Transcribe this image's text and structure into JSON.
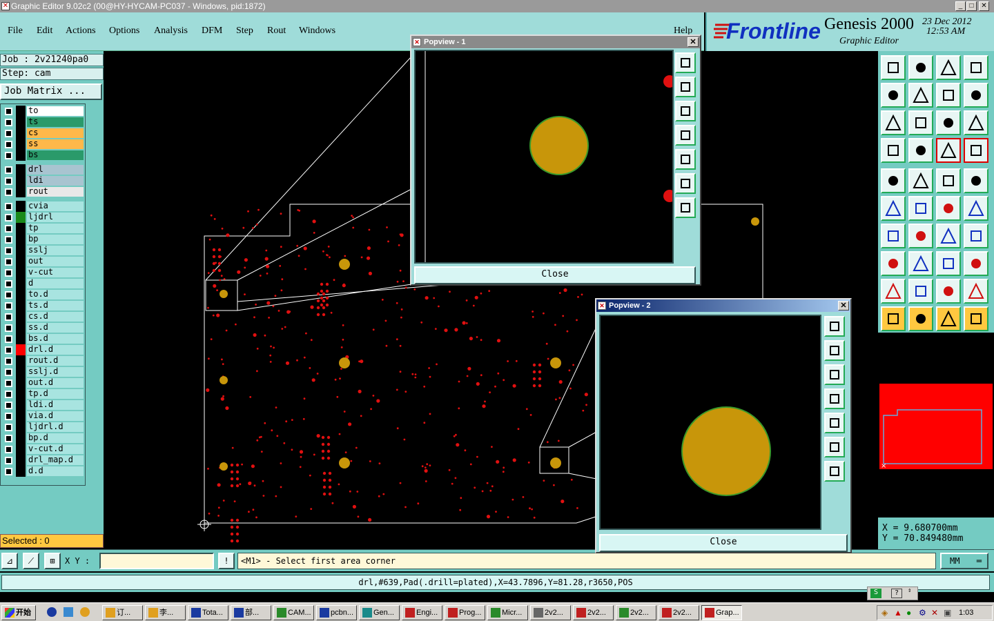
{
  "window": {
    "title": "Graphic Editor 9.02c2 (00@HY-HYCAM-PC037 - Windows, pid:1872)"
  },
  "menu": [
    "File",
    "Edit",
    "Actions",
    "Options",
    "Analysis",
    "DFM",
    "Step",
    "Rout",
    "Windows"
  ],
  "help_label": "Help",
  "logo": {
    "brand": "Frontline",
    "product": "Genesis 2000",
    "subtitle": "Graphic Editor",
    "date": "23 Dec 2012",
    "time": "12:53 AM"
  },
  "job": {
    "job_line": "Job : 2v21240pa0",
    "step_line": "Step: cam",
    "matrix_button": "Job Matrix ..."
  },
  "layers_group1": [
    {
      "name": "to",
      "color": "#ffffff"
    },
    {
      "name": "ts",
      "color": "#2a9a6a"
    },
    {
      "name": "cs",
      "color": "#ffb84a"
    },
    {
      "name": "ss",
      "color": "#ffb84a"
    },
    {
      "name": "bs",
      "color": "#2a9a6a"
    }
  ],
  "layers_group2": [
    {
      "name": "drl",
      "color": "#a8c4d0"
    },
    {
      "name": "ldi",
      "color": "#a8c4d0"
    },
    {
      "name": "rout",
      "color": "#e8e8e8"
    }
  ],
  "layers_group3": [
    "cvia",
    "ljdrl",
    "tp",
    "bp",
    "sslj",
    "out",
    "v-cut",
    "d",
    "to.d",
    "ts.d",
    "cs.d",
    "ss.d",
    "bs.d",
    "drl.d",
    "rout.d",
    "sslj.d",
    "out.d",
    "tp.d",
    "ldi.d",
    "via.d",
    "ljdrl.d",
    "bp.d",
    "v-cut.d",
    "drl_map.d",
    "d.d"
  ],
  "selected_text": "Selected : 0",
  "coords": {
    "x": "X =  9.680700mm",
    "y": "Y = 70.849480mm"
  },
  "cmd": {
    "xy_label": "X Y :",
    "prompt": "<M1> - Select first area corner",
    "units": "MM"
  },
  "status_text": "drl,#639,Pad(.drill=plated),X=43.7896,Y=81.28,r3650,POS",
  "popups": {
    "p1": {
      "title": "Popview - 1",
      "close_label": "Close"
    },
    "p2": {
      "title": "Popview - 2",
      "close_label": "Close"
    }
  },
  "taskbar": {
    "start_label": "开始",
    "clock": "1:03",
    "tasks": [
      "订...",
      "李...",
      "Tota...",
      "部...",
      "CAM...",
      "pcbn...",
      "Gen...",
      "Engi...",
      "Prog...",
      "Micr...",
      "2v2...",
      "2v2...",
      "2v2...",
      "2v2...",
      "Grap..."
    ]
  },
  "colors": {
    "pad": "#c8960a",
    "pad_outline": "#3a9a2a",
    "hole": "#e01010",
    "panel": "#74cbc2"
  }
}
